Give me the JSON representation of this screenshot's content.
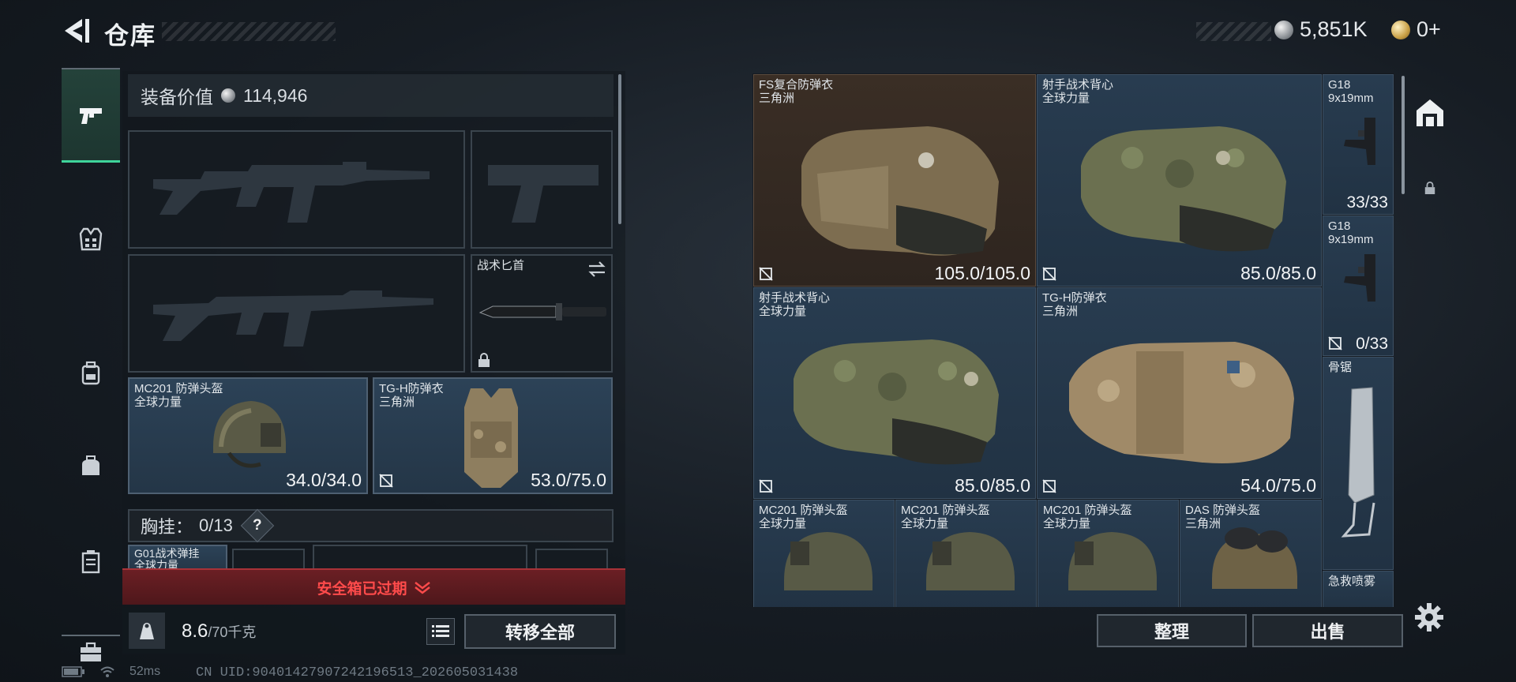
{
  "header": {
    "title": "仓库",
    "currency_silver": "5,851K",
    "currency_gold": "0+"
  },
  "sidebar": {
    "items": [
      {
        "icon": "pistol-icon",
        "active": true
      },
      {
        "icon": "vest-icon"
      },
      {
        "icon": "backpack-icon"
      },
      {
        "icon": "bag-icon"
      },
      {
        "icon": "case-icon"
      },
      {
        "icon": "toolbox-icon"
      }
    ]
  },
  "loadout": {
    "value_label": "装备价值",
    "value": "114,946",
    "melee": {
      "name": "战术匕首"
    },
    "helmet": {
      "name": "MC201 防弹头盔",
      "sub": "全球力量",
      "durability": "34.0/34.0"
    },
    "armor": {
      "name": "TG-H防弹衣",
      "sub": "三角洲",
      "durability": "53.0/75.0"
    },
    "chest_label": "胸挂：",
    "chest_count": "0/13",
    "chest_help": "?",
    "rig_item": {
      "name": "G01战术弹挂",
      "sub": "全球力量"
    },
    "safe_box_expired": "安全箱已过期",
    "weight_value": "8.6",
    "weight_max": "/70千克",
    "transfer_all": "转移全部"
  },
  "storage": {
    "items": [
      {
        "name": "FS复合防弹衣",
        "sub": "三角洲",
        "durability": "105.0/105.0"
      },
      {
        "name": "射手战术背心",
        "sub": "全球力量",
        "durability": "85.0/85.0"
      },
      {
        "name": "G18",
        "sub": "9x19mm",
        "ammo": "33/33"
      },
      {
        "name": "G18",
        "sub": "9x19mm",
        "ammo": "0/33"
      },
      {
        "name": "射手战术背心",
        "sub": "全球力量",
        "durability": "85.0/85.0"
      },
      {
        "name": "TG-H防弹衣",
        "sub": "三角洲",
        "durability": "54.0/75.0"
      },
      {
        "name": "骨锯",
        "sub": ""
      },
      {
        "name": "MC201 防弹头盔",
        "sub": "全球力量"
      },
      {
        "name": "MC201 防弹头盔",
        "sub": "全球力量"
      },
      {
        "name": "MC201 防弹头盔",
        "sub": "全球力量"
      },
      {
        "name": "DAS 防弹头盔",
        "sub": "三角洲"
      },
      {
        "name": "急救喷雾",
        "sub": ""
      }
    ],
    "sort_button": "整理",
    "sell_button": "出售"
  },
  "status_bar": {
    "ping": "52ms",
    "uid": "CN UID:904014279072421965​13_202605031438"
  },
  "colors": {
    "accent_green": "#3fd49b",
    "alert_red": "#ff4b4b",
    "cell_blue": "#283c50"
  }
}
